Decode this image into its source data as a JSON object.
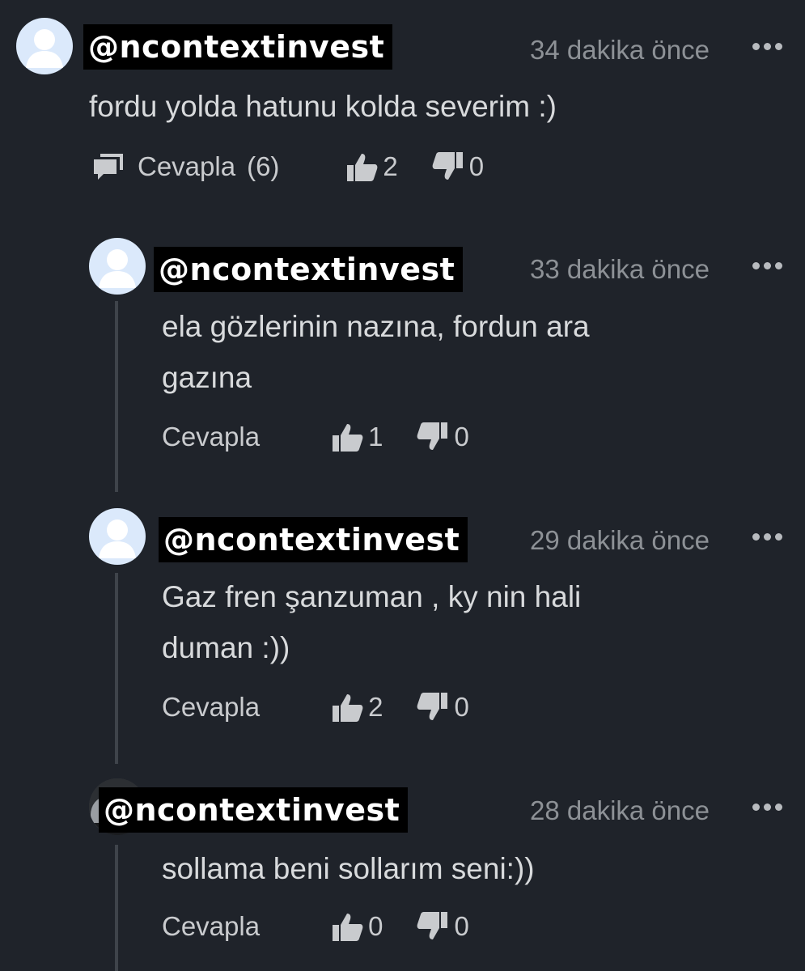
{
  "comments": [
    {
      "username": "@ncontextinvest",
      "time": "34 dakika önce",
      "text": "fordu yolda hatunu kolda severim :)",
      "reply_label": "Cevapla",
      "reply_count": "(6)",
      "likes": "2",
      "dislikes": "0"
    },
    {
      "username": "@ncontextinvest",
      "time": "33 dakika önce",
      "text_line1": "ela gözlerinin nazına, fordun ara",
      "text_line2": "gazına",
      "reply_label": "Cevapla",
      "likes": "1",
      "dislikes": "0"
    },
    {
      "username": "@ncontextinvest",
      "time": "29 dakika önce",
      "text_line1": "Gaz fren şanzuman , ky nin hali",
      "text_line2": "duman :))",
      "reply_label": "Cevapla",
      "likes": "2",
      "dislikes": "0"
    },
    {
      "username": "@ncontextinvest",
      "time": "28 dakika önce",
      "text": "sollama beni sollarım seni:))",
      "reply_label": "Cevapla",
      "likes": "0",
      "dislikes": "0"
    }
  ],
  "icons": {
    "avatar": "default-user-avatar-icon",
    "more": "more-options-icon",
    "reply": "reply-bubble-icon",
    "like": "thumbs-up-icon",
    "dislike": "thumbs-down-icon"
  },
  "colors": {
    "background": "#1f232a",
    "text": "#d8dadc",
    "muted": "#8d9196",
    "username_bg": "#000000"
  }
}
